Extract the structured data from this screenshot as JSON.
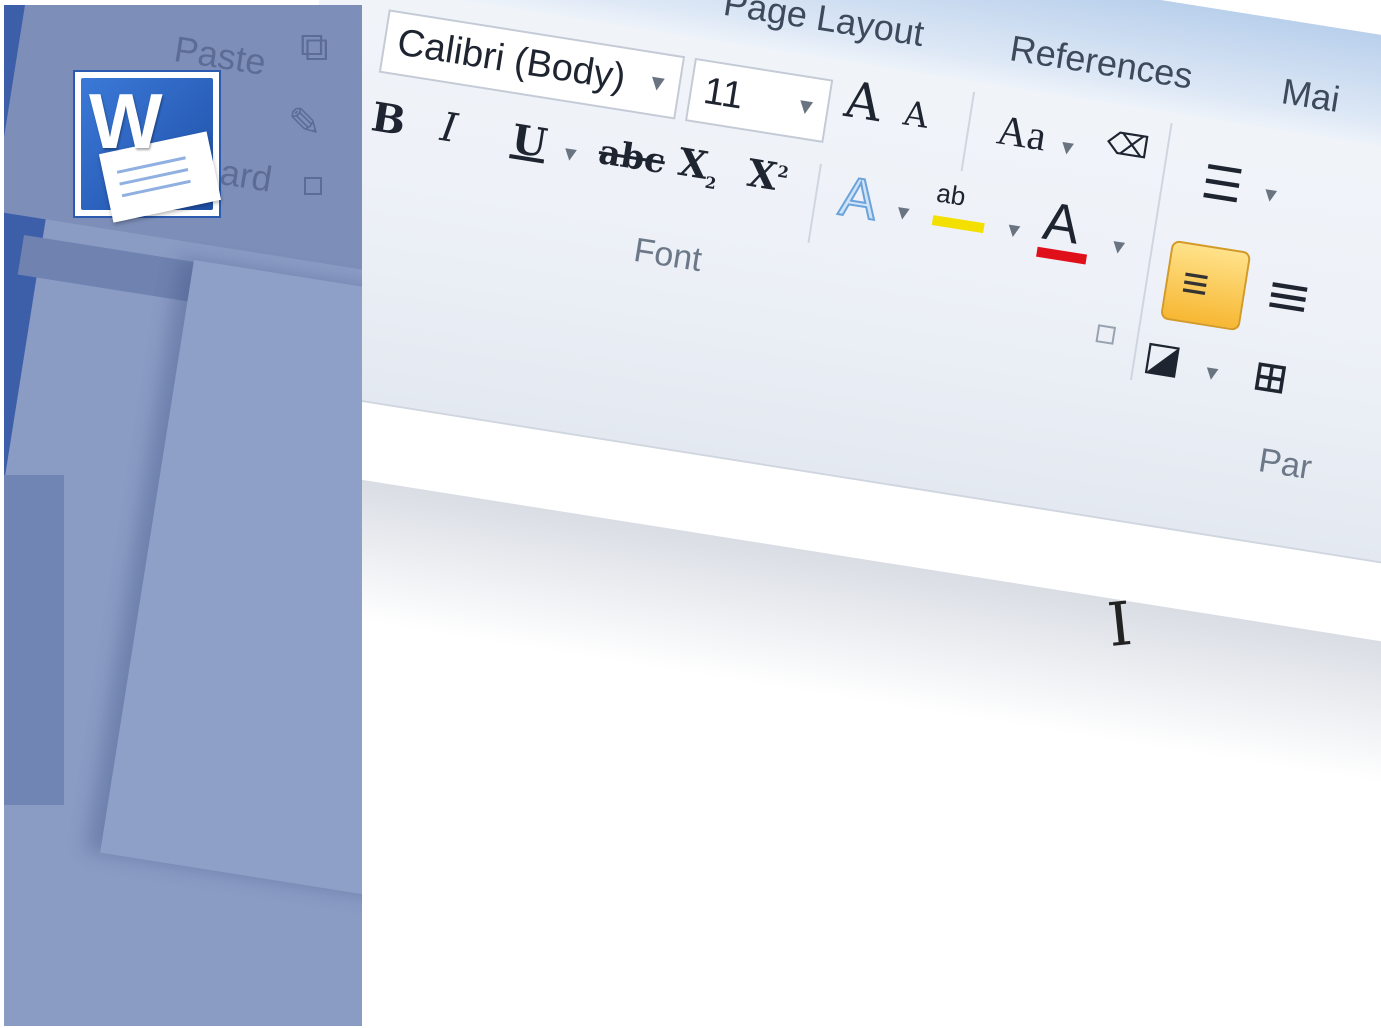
{
  "tabs": {
    "page_layout": "Page Layout",
    "references": "References",
    "mailings": "Mai"
  },
  "font_group": {
    "font_name": "Calibri (Body)",
    "font_size": "11",
    "label": "Font",
    "bold": "B",
    "italic": "I",
    "underline": "U",
    "strikethrough": "abc",
    "subscript": "X",
    "subscript_mark": "2",
    "superscript": "X",
    "superscript_mark": "2",
    "grow_font": "A",
    "shrink_font": "A",
    "change_case": "Aa",
    "text_effects": "A",
    "highlight": "ab",
    "font_color": "A"
  },
  "paragraph_group": {
    "label": "Par"
  },
  "clipboard_group": {
    "paste": "Paste",
    "label_fragment": "ard"
  },
  "logo": {
    "letter": "W"
  },
  "colors": {
    "highlight_yellow": "#f4e000",
    "font_color_red": "#e0101a",
    "overlay": "#8a9bc4",
    "word_blue": "#2a5bb0"
  }
}
